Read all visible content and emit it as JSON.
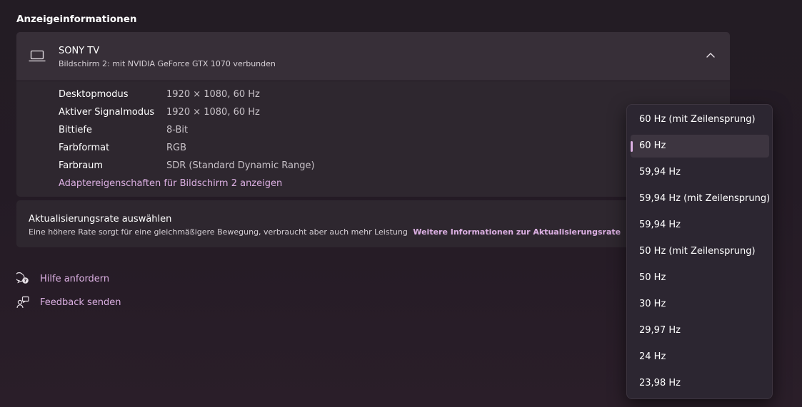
{
  "section_title": "Anzeigeinformationen",
  "display": {
    "icon": "laptop-icon",
    "name": "SONY TV",
    "subtitle": "Bildschirm 2: mit NVIDIA GeForce GTX 1070 verbunden",
    "rows": [
      {
        "label": "Desktopmodus",
        "value": "1920 × 1080, 60 Hz"
      },
      {
        "label": "Aktiver Signalmodus",
        "value": "1920 × 1080, 60 Hz"
      },
      {
        "label": "Bittiefe",
        "value": "8-Bit"
      },
      {
        "label": "Farbformat",
        "value": "RGB"
      },
      {
        "label": "Farbraum",
        "value": "SDR (Standard Dynamic Range)"
      }
    ],
    "adapter_link": "Adaptereigenschaften für Bildschirm 2 anzeigen"
  },
  "refresh": {
    "title": "Aktualisierungsrate auswählen",
    "description": "Eine höhere Rate sorgt für eine gleichmäßigere Bewegung, verbraucht aber auch mehr Leistung",
    "link": "Weitere Informationen zur Aktualisierungsrate"
  },
  "links": [
    {
      "label": "Hilfe anfordern",
      "icon": "help-chat-icon"
    },
    {
      "label": "Feedback senden",
      "icon": "feedback-icon"
    }
  ],
  "dropdown": {
    "selected": "60 Hz",
    "options": [
      "60 Hz (mit Zeilensprung)",
      "60 Hz",
      "59,94 Hz",
      "59,94 Hz (mit Zeilensprung)",
      "59,94 Hz",
      "50 Hz (mit Zeilensprung)",
      "50 Hz",
      "30 Hz",
      "29,97 Hz",
      "24 Hz",
      "23,98 Hz"
    ]
  },
  "colors": {
    "accent": "#dcb0e3",
    "background": "#241b25",
    "card": "#2e272f"
  }
}
